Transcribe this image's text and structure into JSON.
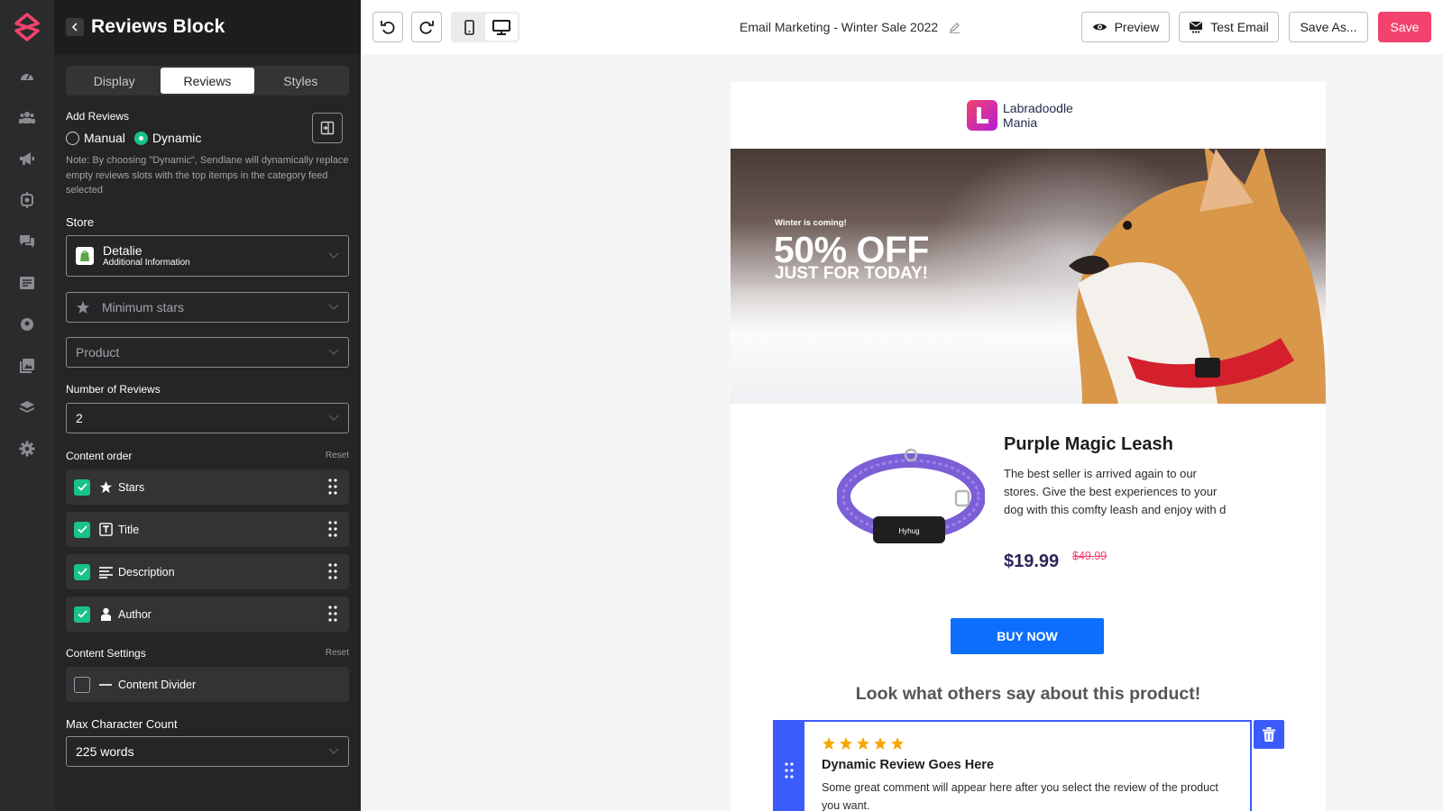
{
  "panel": {
    "title": "Reviews Block",
    "tabs": [
      {
        "label": "Display"
      },
      {
        "label": "Reviews"
      },
      {
        "label": "Styles"
      }
    ],
    "add_reviews_label": "Add Reviews",
    "mode_options": [
      "Manual",
      "Dynamic"
    ],
    "mode_selected": "Dynamic",
    "note": "Note: By choosing \"Dynamic\", Sendlane will dynamically replace empty reviews slots with the top itemps in the category feed selected",
    "store_label": "Store",
    "store": {
      "name": "Detalie",
      "sub": "Additional Information"
    },
    "min_stars_placeholder": "Minimum stars",
    "product_placeholder": "Product",
    "num_reviews_label": "Number of Reviews",
    "num_reviews_value": "2",
    "content_order_label": "Content order",
    "reset_label": "Reset",
    "content_order": [
      {
        "label": "Stars",
        "checked": true,
        "icon": "star-icon"
      },
      {
        "label": "Title",
        "checked": true,
        "icon": "title-icon"
      },
      {
        "label": "Description",
        "checked": true,
        "icon": "description-icon"
      },
      {
        "label": "Author",
        "checked": true,
        "icon": "author-icon"
      }
    ],
    "content_settings_label": "Content  Settings",
    "content_divider": {
      "label": "Content Divider",
      "checked": false
    },
    "max_char_label": "Max Character Count",
    "max_char_value": "225 words"
  },
  "toolbar": {
    "doc_title": "Email Marketing - Winter Sale 2022",
    "preview_label": "Preview",
    "test_email_label": "Test Email",
    "save_as_label": "Save As...",
    "save_label": "Save",
    "device_selected": "desktop"
  },
  "email": {
    "brand_line1": "Labradoodle",
    "brand_line2": "Mania",
    "hero_small": "Winter is coming!",
    "hero_big": "50% OFF",
    "hero_mid": "JUST FOR TODAY!",
    "product_title": "Purple Magic Leash",
    "product_desc": "The best seller is arrived again to our stores. Give the best experiences to your dog with this comfty leash and enjoy with d",
    "price": "$19.99",
    "old_price": "$49.99",
    "collar_tag": "Hyhug",
    "buy_label": "BUY NOW",
    "reviews_heading": "Look what others say about this product!",
    "review": {
      "stars": 5,
      "title": "Dynamic Review Goes Here",
      "text": "Some great comment will appear here after you select the review of the product you want."
    }
  },
  "colors": {
    "accent": "#f2426d",
    "primary_blue": "#0d6efd",
    "selection_blue": "#3b5bfd",
    "check_green": "#19c28b",
    "star": "#f7a600"
  }
}
